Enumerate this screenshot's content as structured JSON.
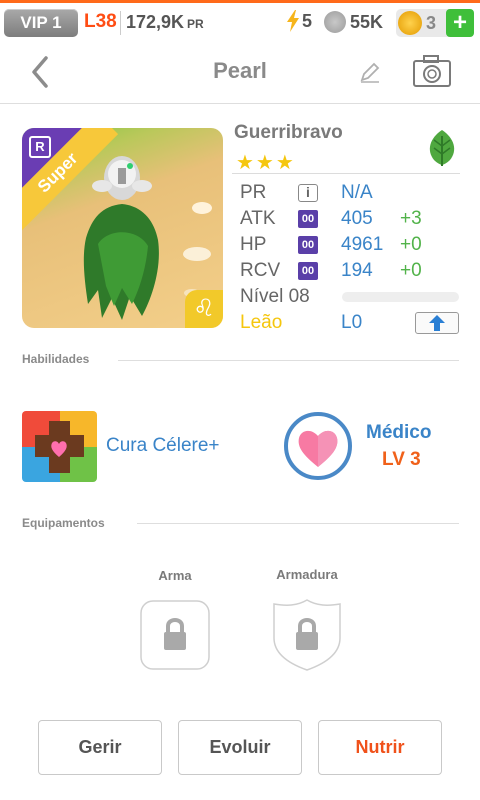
{
  "statusbar": {
    "vip": "VIP 1",
    "level": "L38",
    "power": "172,9K",
    "power_unit": "PR",
    "energy": "5",
    "coins": "55K",
    "gems": "3",
    "plus": "+"
  },
  "header": {
    "title": "Pearl",
    "icons": [
      "back-arrow-icon",
      "pencil-icon",
      "camera-icon"
    ]
  },
  "card": {
    "rarity": "R",
    "tag": "Super",
    "zodiac_symbol": "♌"
  },
  "monster": {
    "name": "Guerribravo",
    "stars": "★★★",
    "element_icon": "leaf-icon",
    "stats": [
      {
        "label": "PR",
        "value": "N/A",
        "bonus": "",
        "icon": "i"
      },
      {
        "label": "ATK",
        "value": "405",
        "bonus": "+3",
        "icon": "00"
      },
      {
        "label": "HP",
        "value": "4961",
        "bonus": "+0",
        "icon": "00"
      },
      {
        "label": "RCV",
        "value": "194",
        "bonus": "+0",
        "icon": "00"
      }
    ],
    "level_label": "Nível 08",
    "level_progress": 0,
    "zodiac_label": "Leão",
    "zodiac_level": "L0",
    "colors": {
      "zodiac": "#f5c60d",
      "stat_value": "#3a84c8",
      "bonus": "#52b34a"
    }
  },
  "skills": {
    "section_title": "Habilidades",
    "active_name": "Cura Célere+",
    "leader_name": "Médico",
    "leader_level": "LV 3"
  },
  "equipment": {
    "section_title": "Equipamentos",
    "weapon_label": "Arma",
    "armor_label": "Armadura"
  },
  "actions": {
    "manage": "Gerir",
    "evolve": "Evoluir",
    "feed": "Nutrir"
  }
}
